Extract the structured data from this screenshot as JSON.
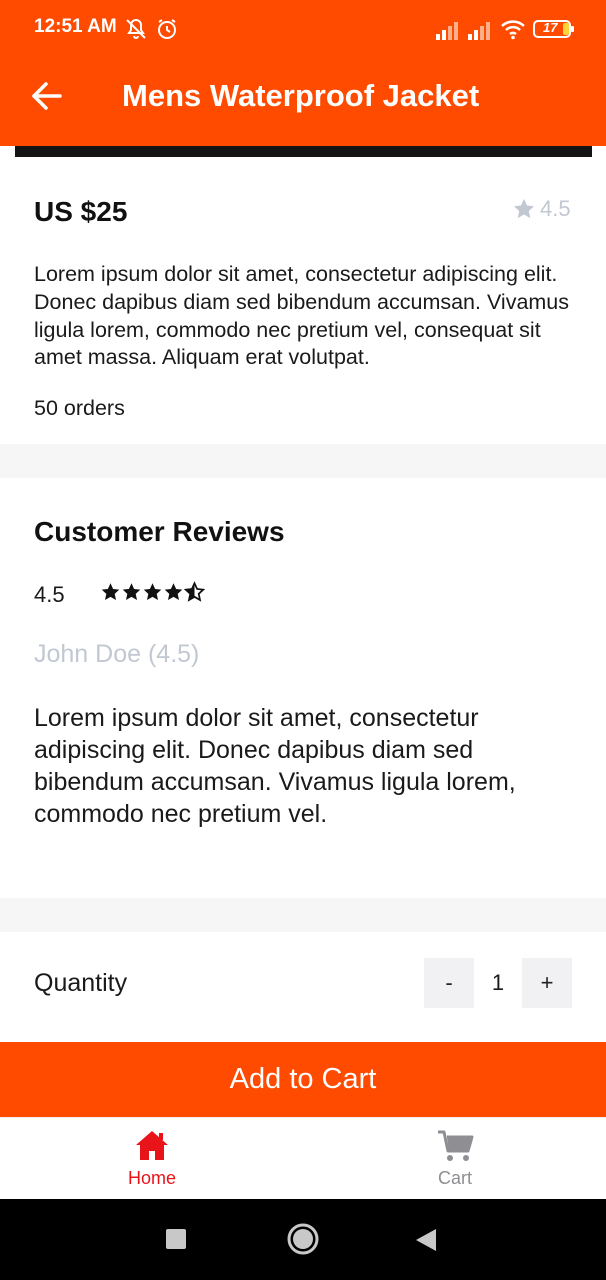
{
  "status_bar": {
    "time": "12:51 AM",
    "battery": "17",
    "icons": [
      "notifications-off-icon",
      "alarm-icon",
      "signal-icon",
      "signal-icon",
      "wifi-icon",
      "battery-icon"
    ]
  },
  "app_bar": {
    "title": "Mens Waterproof Jacket",
    "back_icon": "arrow-left-icon"
  },
  "product": {
    "price": "US $25",
    "rating": "4.5",
    "description": "Lorem ipsum dolor sit amet, consectetur adipiscing elit. Donec dapibus diam sed bibendum accumsan. Vivamus ligula lorem, commodo nec pretium vel, consequat sit amet massa. Aliquam erat volutpat.",
    "orders": "50 orders"
  },
  "reviews": {
    "title": "Customer Reviews",
    "average": "4.5",
    "stars": 4.5,
    "items": [
      {
        "author": "John Doe (4.5)",
        "text": "Lorem ipsum dolor sit amet, consectetur adipiscing elit. Donec dapibus diam sed bibendum accumsan. Vivamus ligula lorem, commodo nec pretium vel."
      }
    ]
  },
  "quantity": {
    "label": "Quantity",
    "minus": "-",
    "value": "1",
    "plus": "+"
  },
  "cta": {
    "add_to_cart": "Add to Cart"
  },
  "bottom_nav": {
    "items": [
      {
        "label": "Home",
        "icon": "home-icon",
        "active": true
      },
      {
        "label": "Cart",
        "icon": "cart-icon",
        "active": false
      }
    ]
  },
  "colors": {
    "brand": "#fe4b00",
    "active_nav": "#e8141a",
    "muted": "#c2c8d2"
  }
}
